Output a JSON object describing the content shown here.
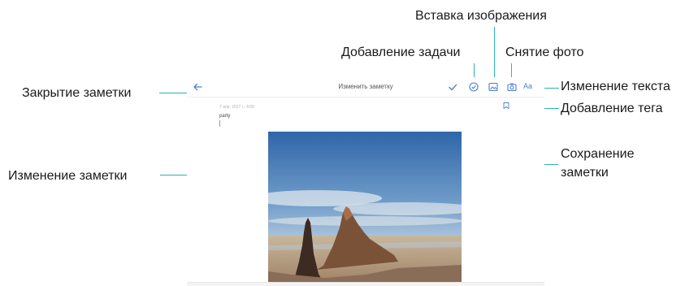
{
  "annotations": {
    "insert_image": "Вставка изображения",
    "add_task": "Добавление задачи",
    "take_photo": "Снятие фото",
    "close_note": "Закрытие заметки",
    "edit_text": "Изменение текста",
    "add_tag": "Добавление тега",
    "save_note_line1": "Сохранение",
    "save_note_line2": "заметки",
    "edit_note": "Изменение заметки"
  },
  "screen": {
    "title": "Изменить заметку",
    "date": "7 апр. 2017 г., 4:09",
    "note_text": "party",
    "text_format_label": "Aa"
  },
  "colors": {
    "accent": "#2bb3b3",
    "icon": "#4a7fd1"
  },
  "icons": [
    "back-arrow-icon",
    "check-icon",
    "task-icon",
    "image-icon",
    "camera-icon",
    "text-format-icon",
    "tag-icon"
  ]
}
